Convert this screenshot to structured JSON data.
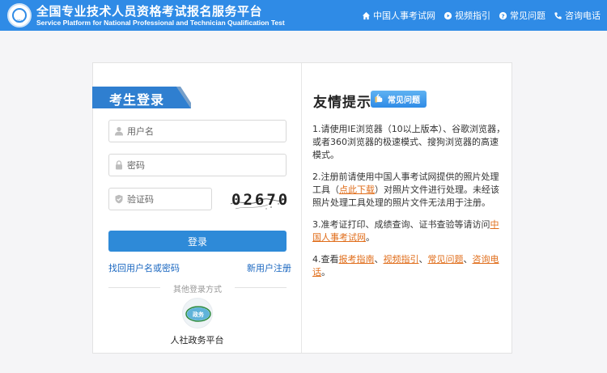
{
  "header": {
    "title_cn": "全国专业技术人员资格考试报名服务平台",
    "title_en": "Service Platform for National Professional and Technician Qualification Test",
    "logo_text": "PTA",
    "nav": [
      {
        "label": "中国人事考试网",
        "icon": "home-icon"
      },
      {
        "label": "视频指引",
        "icon": "video-icon"
      },
      {
        "label": "常见问题",
        "icon": "question-icon"
      },
      {
        "label": "咨询电话",
        "icon": "phone-icon"
      }
    ]
  },
  "login": {
    "tab_label": "考生登录",
    "username_placeholder": "用户名",
    "password_placeholder": "密码",
    "captcha_placeholder": "验证码",
    "captcha_text": "02670",
    "login_button": "登录",
    "forgot_link": "找回用户名或密码",
    "register_link": "新用户注册",
    "other_methods": "其他登录方式",
    "platform_label": "人社政务平台",
    "platform_icon_text": "政务"
  },
  "tips": {
    "title": "友情提示",
    "faq_button": "常见问题",
    "items": [
      {
        "text": "1.请使用IE浏览器（10以上版本）、谷歌浏览器，或者360浏览器的极速模式、搜狗浏览器的高速模式。"
      },
      {
        "before": "2.注册前请使用中国人事考试网提供的照片处理工具（",
        "link": "点此下载",
        "after": "）对照片文件进行处理。未经该照片处理工具处理的照片文件无法用于注册。"
      },
      {
        "before": "3.准考证打印、成绩查询、证书查验等请访问",
        "link": "中国人事考试网",
        "after": "。"
      },
      {
        "before": "4.查看",
        "links": [
          "报考指南",
          "视频指引",
          "常见问题",
          "咨询电话"
        ],
        "after": "。"
      }
    ]
  },
  "colors": {
    "header_bg": "#2f8be6",
    "tab_bg": "#2f7fd0",
    "button_bg": "#2e8ad8",
    "link": "#1a67c0",
    "tip_link": "#e06d1a"
  }
}
